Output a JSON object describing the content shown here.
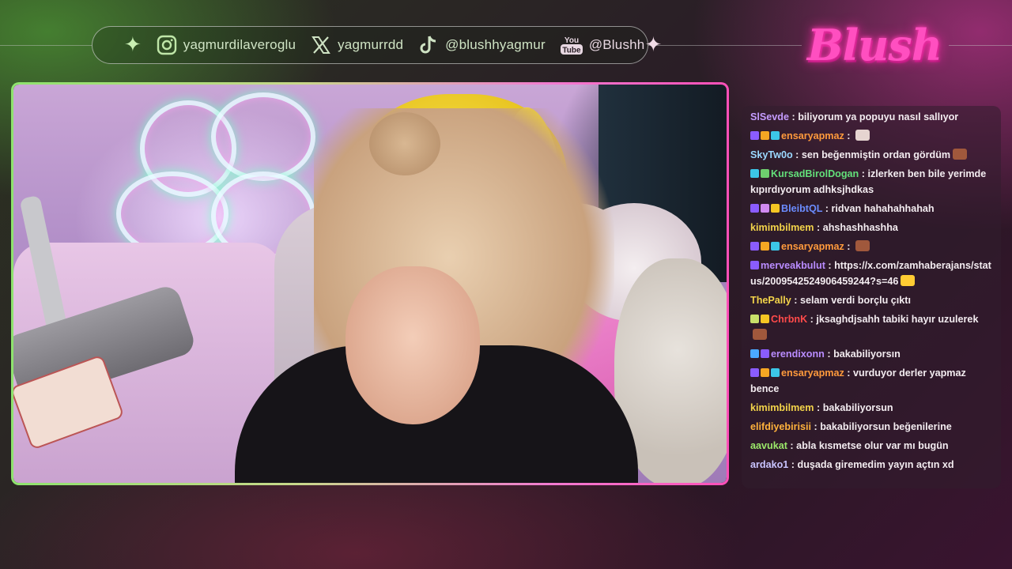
{
  "overlay": {
    "socials": [
      {
        "icon": "instagram-icon",
        "handle": "yagmurdilaveroglu"
      },
      {
        "icon": "x-twitter-icon",
        "handle": "yagmurrdd"
      },
      {
        "icon": "tiktok-icon",
        "handle": "@blushhyagmur"
      },
      {
        "icon": "youtube-icon",
        "icon_text_top": "You",
        "icon_text_bottom": "Tube",
        "handle": "@Blushh"
      }
    ],
    "logo_text": "Blush",
    "accent_green": "#8ee36e",
    "accent_pink": "#ff4fb8"
  },
  "chat": {
    "messages": [
      {
        "user": "SlSevde",
        "color": "#c59cff",
        "badges": [],
        "text": "biliyorum ya popuyu nasıl sallıyor"
      },
      {
        "user": "ensaryapmaz",
        "color": "#ff9a3c",
        "badges": [
          "#8a5cff",
          "#f5a623",
          "#3cc6e8"
        ],
        "text": "",
        "emote": "#e6d4d0"
      },
      {
        "user": "SkyTw0o",
        "color": "#9bd8ff",
        "badges": [],
        "text": "sen beğenmiştin ordan gördüm",
        "emote": "#a0583c"
      },
      {
        "user": "KursadBirolDogan",
        "color": "#63e07a",
        "badges": [
          "#3cc6e8",
          "#6ecf6e"
        ],
        "text": "izlerken ben bile yerimde kıpırdıyorum adhksjhdkas"
      },
      {
        "user": "BleibtQL",
        "color": "#6b8cff",
        "badges": [
          "#8a5cff",
          "#d08af0",
          "#f5c623"
        ],
        "text": "ridvan hahahahhahah"
      },
      {
        "user": "kimimbilmem",
        "color": "#f2d34a",
        "badges": [],
        "text": "ahshashhashha"
      },
      {
        "user": "ensaryapmaz",
        "color": "#ff9a3c",
        "badges": [
          "#8a5cff",
          "#f5a623",
          "#3cc6e8"
        ],
        "text": "",
        "emote": "#a0583c"
      },
      {
        "user": "merveakbulut",
        "color": "#b98cff",
        "badges": [
          "#8a5cff"
        ],
        "text": "https://x.com/zamhaberajans/status/2009542524906459244?s=46",
        "emote": "#ffcc33"
      },
      {
        "user": "ThePally",
        "color": "#f2d34a",
        "badges": [],
        "text": "selam verdi borçlu çıktı"
      },
      {
        "user": "ChrbnK",
        "color": "#ff4a4a",
        "badges": [
          "#c8e06a",
          "#f5c623"
        ],
        "text": "jksaghdjsahh tabiki hayır uzulerek",
        "emote": "#a0583c"
      },
      {
        "user": "erendixonn",
        "color": "#b98cff",
        "badges": [
          "#4aa8ff",
          "#8a5cff"
        ],
        "text": "bakabiliyorsın"
      },
      {
        "user": "ensaryapmaz",
        "color": "#ff9a3c",
        "badges": [
          "#8a5cff",
          "#f5a623",
          "#3cc6e8"
        ],
        "text": "vurduyor derler yapmaz bence"
      },
      {
        "user": "kimimbilmem",
        "color": "#f2d34a",
        "badges": [],
        "text": "bakabiliyorsun"
      },
      {
        "user": "elifdiyebirisii",
        "color": "#ffb23c",
        "badges": [],
        "text": "bakabiliyorsun beğenilerine"
      },
      {
        "user": "aavukat",
        "color": "#9be86a",
        "badges": [],
        "text": "abla kısmetse olur var mı bugün"
      },
      {
        "user": "ardako1",
        "color": "#c9c4ff",
        "badges": [],
        "text": "duşada giremedim yayın açtın xd"
      }
    ]
  }
}
